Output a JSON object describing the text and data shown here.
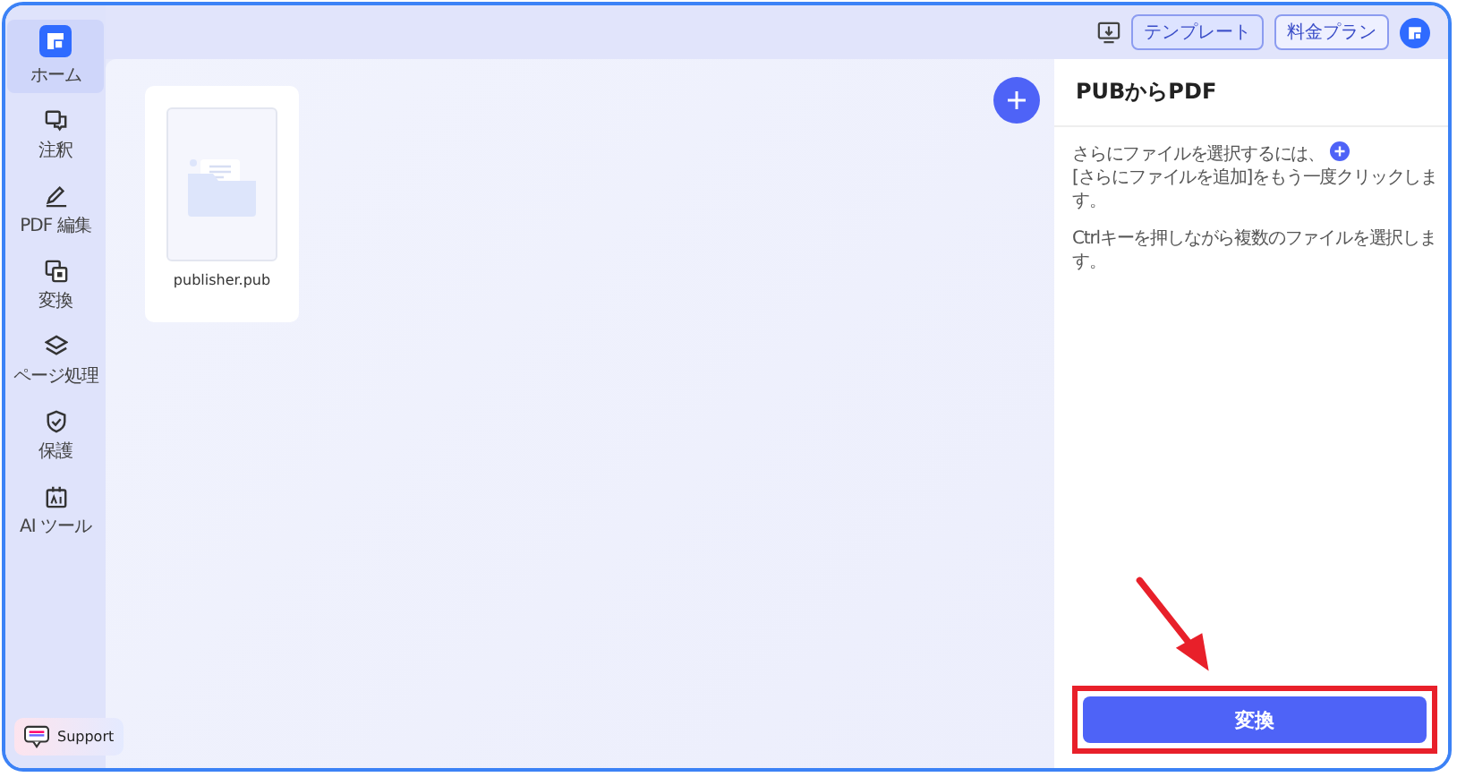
{
  "sidebar": {
    "items": [
      {
        "label": "ホーム",
        "selected": true
      },
      {
        "label": "注釈",
        "selected": false
      },
      {
        "label": "PDF 編集",
        "selected": false
      },
      {
        "label": "変換",
        "selected": false
      },
      {
        "label": "ページ処理",
        "selected": false
      },
      {
        "label": "保護",
        "selected": false
      },
      {
        "label": "AI ツール",
        "selected": false
      }
    ],
    "support": "Support"
  },
  "topbar": {
    "buttons": [
      "テンプレート",
      "料金プラン"
    ]
  },
  "files": [
    {
      "name": "publisher.pub"
    }
  ],
  "panel": {
    "title": "PUBからPDF",
    "hint_before": "さらにファイルを選択するには、",
    "hint_after": "[さらにファイルを追加]をもう一度クリックします。",
    "hint2": "Ctrlキーを押しながら複数のファイルを選択します。",
    "convert_button": "変換"
  }
}
